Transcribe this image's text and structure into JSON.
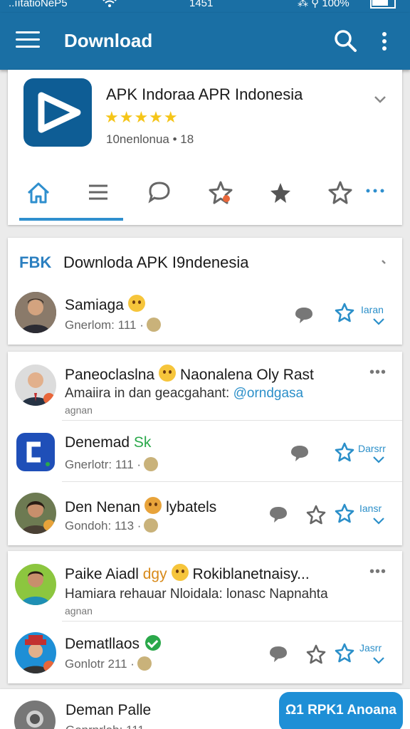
{
  "status_bar": {
    "carrier": "..ııtatioNeP5",
    "time": "1451",
    "right": "⁂ ⚲ 100%"
  },
  "app_bar": {
    "title": "Download"
  },
  "app_card": {
    "title": "APK Indoraa APR Indonesia",
    "rating_stars": "★★★★★",
    "meta": "10nenlonua • 18"
  },
  "tabs": [
    "home",
    "list",
    "comments",
    "starred-badge",
    "favorite",
    "star-outline",
    "more"
  ],
  "section": {
    "tag": "FBK",
    "title": "Downloda APK I9ndenesia"
  },
  "posts": [
    {
      "name": "Samiaga",
      "meta": "Gnerlom: 111 ·",
      "action_label": "Iaran"
    },
    {
      "name": "Paneoclaslna",
      "name_suffix": "Naonalena Oly Rast",
      "description": "Amaiira in dan geacgahant:",
      "description_tag": "@orndgasa",
      "small": "agnan"
    },
    {
      "name": "Denemad",
      "name_suffix": "Sk",
      "meta": "Gnerlotr: 111 ·",
      "action_label": "Darsrr"
    },
    {
      "name": "Den Nenan",
      "name_suffix": "lybatels",
      "meta": "Gondoh: 113 ·",
      "action_label": "Iansr"
    },
    {
      "name": "Paike Aiadl",
      "name_suffix": "dgy",
      "name_suffix2": "Rokiblanetnaisy...",
      "description": "Hamiara rehauar Nloidala: lonasc Napnahta",
      "small": "agnan"
    },
    {
      "name": "Dematllaos",
      "meta": "Gonlotr 211 ·",
      "action_label": "Jasrr"
    },
    {
      "name": "Deman Palle",
      "meta": "Gonrnrlob: 111 ·"
    }
  ],
  "fab": {
    "label": "Ω1 RPK1 Anoana"
  },
  "colors": {
    "primary": "#1a6fa4",
    "accent": "#2b8fc9",
    "star": "#f5c518",
    "fab": "#1e8fd6"
  }
}
